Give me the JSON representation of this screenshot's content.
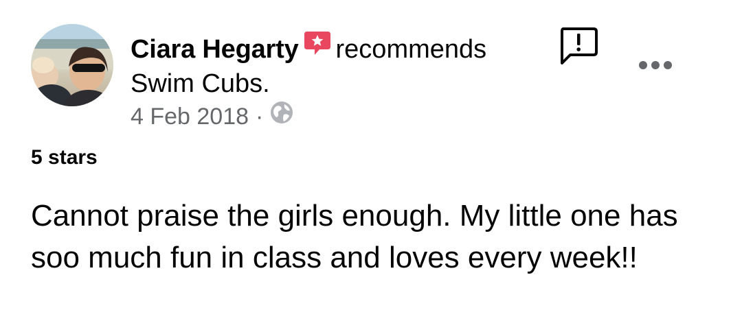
{
  "post": {
    "author_name": "Ciara Hegarty",
    "action": "recommends",
    "page_name": "Swim Cubs.",
    "date": "4 Feb 2018",
    "separator": "·",
    "privacy_icon": "globe-icon",
    "recommend_icon": "recommend-star-icon",
    "rating": "5 stars",
    "review_text": "Cannot praise the girls enough. My little one has soo much fun in class and loves every week!!"
  },
  "actions": {
    "report_icon": "report-icon",
    "more_icon": "more-options-icon"
  },
  "colors": {
    "text": "#050505",
    "secondary": "#65676b",
    "recommend_badge": "#e8475f"
  }
}
